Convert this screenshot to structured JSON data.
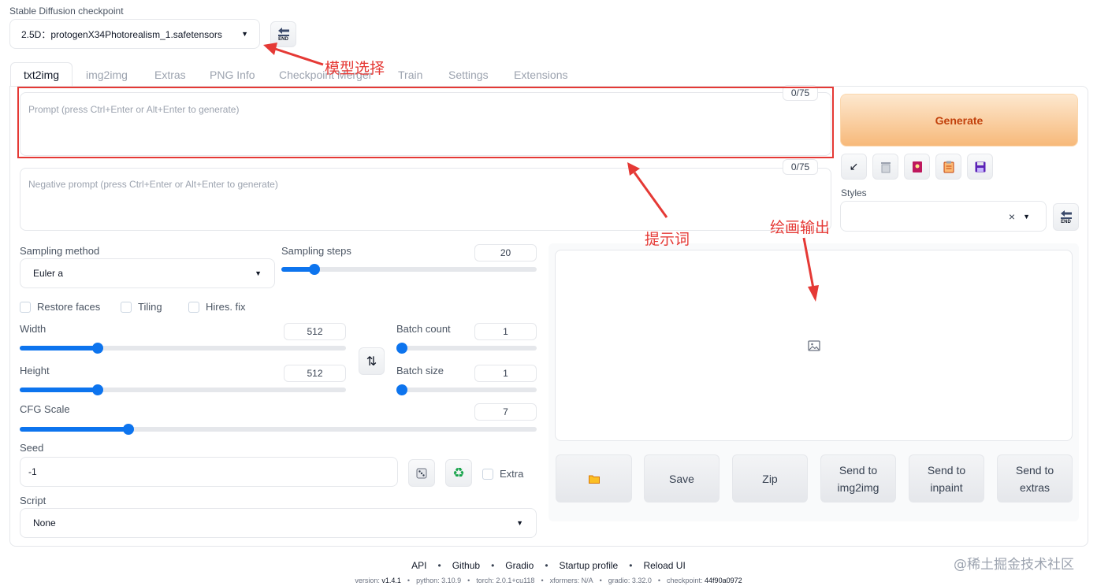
{
  "checkpoint": {
    "label": "Stable Diffusion checkpoint",
    "value": "2.5D：protogenX34Photorealism_1.safetensors",
    "refresh_label": "END"
  },
  "tabs": [
    "txt2img",
    "img2img",
    "Extras",
    "PNG Info",
    "Checkpoint Merger",
    "Train",
    "Settings",
    "Extensions"
  ],
  "prompt": {
    "placeholder": "Prompt (press Ctrl+Enter or Alt+Enter to generate)",
    "counter": "0/75"
  },
  "negative_prompt": {
    "placeholder": "Negative prompt (press Ctrl+Enter or Alt+Enter to generate)",
    "counter": "0/75"
  },
  "generate_label": "Generate",
  "tool_icons": [
    "arrow-icon",
    "trash-icon",
    "card-icon",
    "clipboard-icon",
    "save-icon"
  ],
  "styles": {
    "label": "Styles",
    "clear": "×",
    "refresh_label": "END"
  },
  "sampling": {
    "method_label": "Sampling method",
    "method_value": "Euler a",
    "steps_label": "Sampling steps",
    "steps_value": "20",
    "steps_fraction": 0.13
  },
  "checkboxes": {
    "restore_faces": "Restore faces",
    "tiling": "Tiling",
    "hires_fix": "Hires. fix"
  },
  "width": {
    "label": "Width",
    "value": "512",
    "fraction": 0.24
  },
  "height": {
    "label": "Height",
    "value": "512",
    "fraction": 0.24
  },
  "batch_count": {
    "label": "Batch count",
    "value": "1",
    "fraction": 0.0
  },
  "batch_size": {
    "label": "Batch size",
    "value": "1",
    "fraction": 0.0
  },
  "swap_icon": "⇅",
  "cfg": {
    "label": "CFG Scale",
    "value": "7",
    "fraction": 0.21
  },
  "seed": {
    "label": "Seed",
    "value": "-1",
    "extra_label": "Extra"
  },
  "script": {
    "label": "Script",
    "value": "None"
  },
  "output_buttons": {
    "save": "Save",
    "zip": "Zip",
    "img2img_1": "Send to",
    "img2img_2": "img2img",
    "inpaint_1": "Send to",
    "inpaint_2": "inpaint",
    "extras_1": "Send to",
    "extras_2": "extras"
  },
  "annotations": {
    "model": "模型选择",
    "prompt": "提示词",
    "output": "绘画输出"
  },
  "footer": {
    "links": [
      "API",
      "Github",
      "Gradio",
      "Startup profile",
      "Reload UI"
    ],
    "version_line": [
      {
        "k": "version: ",
        "v": "v1.4.1"
      },
      {
        "k": "python: ",
        "v": "3.10.9"
      },
      {
        "k": "torch: ",
        "v": "2.0.1+cu118"
      },
      {
        "k": "xformers: ",
        "v": "N/A"
      },
      {
        "k": "gradio: ",
        "v": "3.32.0"
      },
      {
        "k": "checkpoint: ",
        "v": "44f90a0972"
      }
    ]
  },
  "watermark": "@稀土掘金技术社区",
  "colors": {
    "accent": "#0d74ee",
    "generate_from": "#fde8cf",
    "generate_to": "#f7b97a",
    "generate_text": "#c2410c",
    "annotation_red": "#e53935"
  }
}
